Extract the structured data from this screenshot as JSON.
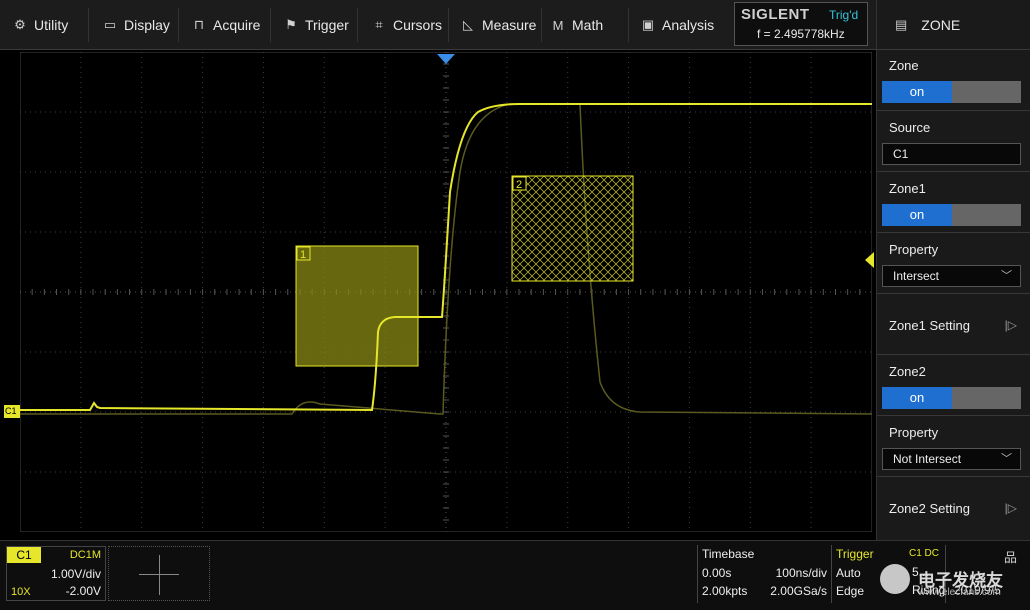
{
  "menu": {
    "items": [
      {
        "label": "Utility",
        "icon": "gear-icon",
        "glyph": "⚙"
      },
      {
        "label": "Display",
        "icon": "monitor-icon",
        "glyph": "▭"
      },
      {
        "label": "Acquire",
        "icon": "acquire-icon",
        "glyph": "⊓"
      },
      {
        "label": "Trigger",
        "icon": "flag-icon",
        "glyph": "⚑"
      },
      {
        "label": "Cursors",
        "icon": "crosshair-icon",
        "glyph": "⌗"
      },
      {
        "label": "Measure",
        "icon": "measure-icon",
        "glyph": "◺"
      },
      {
        "label": "Math",
        "icon": "math-icon",
        "glyph": "M"
      },
      {
        "label": "Analysis",
        "icon": "analysis-icon",
        "glyph": "▣"
      }
    ]
  },
  "status": {
    "brand": "SIGLENT",
    "trigger_state": "Trig'd",
    "frequency": "f = 2.495778kHz"
  },
  "panel": {
    "title": "ZONE",
    "title_icon": "document-icon",
    "zone": {
      "label": "Zone",
      "value": "on"
    },
    "source": {
      "label": "Source",
      "value": "C1"
    },
    "zone1": {
      "label": "Zone1",
      "value": "on"
    },
    "property1": {
      "label": "Property",
      "value": "Intersect"
    },
    "zone1_setting": "Zone1 Setting",
    "zone2": {
      "label": "Zone2",
      "value": "on"
    },
    "property2": {
      "label": "Property",
      "value": "Not Intersect"
    },
    "zone2_setting": "Zone2 Setting"
  },
  "display": {
    "zone1_marker": "1",
    "zone2_marker": "2",
    "channel_marker": "C1",
    "trace_color": "#e6e62a",
    "trigger_marker_color": "#3a8ee8"
  },
  "channel": {
    "name": "C1",
    "coupling": "DC1M",
    "volts_per_div": "1.00V/div",
    "probe": "10X",
    "offset": "-2.00V"
  },
  "timebase": {
    "title": "Timebase",
    "delay": "0.00s",
    "time_per_div": "100ns/div",
    "memory_depth": "2.00kpts",
    "sample_rate": "2.00GSa/s"
  },
  "trigger": {
    "title": "Trigger",
    "source": "C1 DC",
    "mode": "Auto",
    "type": "Edge",
    "level": "5...",
    "slope": "Rising"
  },
  "system": {
    "network_icon": "network-icon",
    "date": "2019/9/5"
  },
  "watermark": {
    "text": "电子发烧友",
    "url": "www.elecfans.com"
  }
}
